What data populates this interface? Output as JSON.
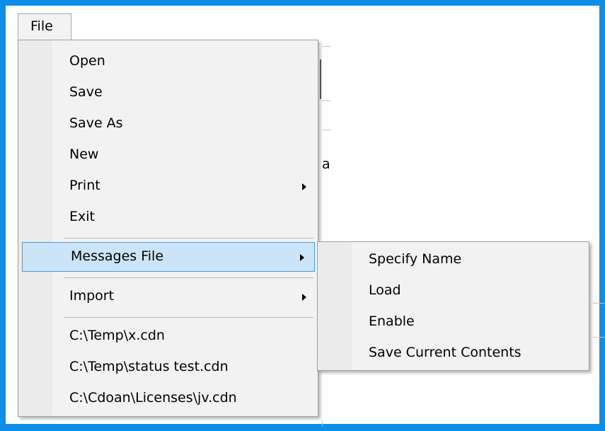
{
  "menubar": {
    "file_label": "File"
  },
  "file_menu": {
    "items": [
      {
        "label": "Open"
      },
      {
        "label": "Save"
      },
      {
        "label": "Save As"
      },
      {
        "label": "New"
      },
      {
        "label": "Print"
      },
      {
        "label": "Exit"
      },
      {
        "label": "Messages File"
      },
      {
        "label": "Import"
      }
    ],
    "recent_files": [
      "C:\\Temp\\x.cdn",
      "C:\\Temp\\status test.cdn",
      "C:\\Cdoan\\Licenses\\jv.cdn"
    ]
  },
  "messages_submenu": {
    "items": [
      {
        "label": "Specify Name"
      },
      {
        "label": "Load"
      },
      {
        "label": "Enable"
      },
      {
        "label": "Save Current Contents"
      }
    ]
  },
  "background": {
    "fragment": "a"
  }
}
